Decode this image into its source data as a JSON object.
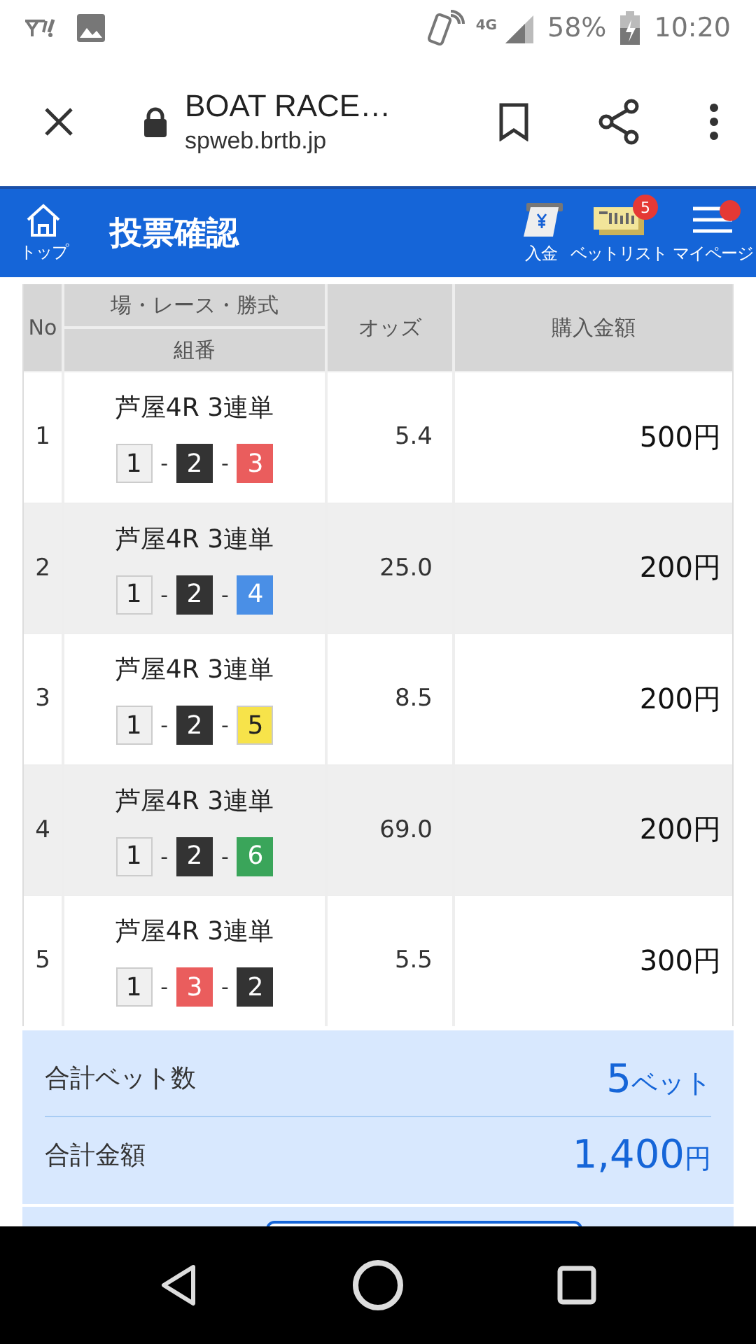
{
  "status_bar": {
    "battery": "58%",
    "time": "10:20",
    "network": "4G"
  },
  "browser": {
    "title": "BOAT RACE…",
    "url": "spweb.brtb.jp"
  },
  "header": {
    "home_label": "トップ",
    "title": "投票確認",
    "actions": [
      {
        "label": "入金",
        "kind": "deposit"
      },
      {
        "label": "ベットリスト",
        "kind": "betlist",
        "badge": "5"
      },
      {
        "label": "マイページ",
        "kind": "mypage",
        "dot": true
      }
    ]
  },
  "table": {
    "columns": [
      "No",
      "場・レース・勝式",
      "組番",
      "オッズ",
      "購入金額"
    ],
    "rows": [
      {
        "no": "1",
        "race": "芦屋4R 3連単",
        "combo": [
          {
            "num": "1",
            "color": "#f0f0f0"
          },
          {
            "num": "2",
            "color": "#333333"
          },
          {
            "num": "3",
            "color": "#ea5d5d"
          }
        ],
        "odds": "5.4",
        "amount": "500円"
      },
      {
        "no": "2",
        "race": "芦屋4R 3連単",
        "combo": [
          {
            "num": "1",
            "color": "#f0f0f0"
          },
          {
            "num": "2",
            "color": "#333333"
          },
          {
            "num": "4",
            "color": "#4a8fe6"
          }
        ],
        "odds": "25.0",
        "amount": "200円"
      },
      {
        "no": "3",
        "race": "芦屋4R 3連単",
        "combo": [
          {
            "num": "1",
            "color": "#f0f0f0"
          },
          {
            "num": "2",
            "color": "#333333"
          },
          {
            "num": "5",
            "color": "#f7e34a"
          }
        ],
        "odds": "8.5",
        "amount": "200円"
      },
      {
        "no": "4",
        "race": "芦屋4R 3連単",
        "combo": [
          {
            "num": "1",
            "color": "#f0f0f0"
          },
          {
            "num": "2",
            "color": "#333333"
          },
          {
            "num": "6",
            "color": "#3aa55a"
          }
        ],
        "odds": "69.0",
        "amount": "200円"
      },
      {
        "no": "5",
        "race": "芦屋4R 3連単",
        "combo": [
          {
            "num": "1",
            "color": "#f0f0f0"
          },
          {
            "num": "3",
            "color": "#ea5d5d"
          },
          {
            "num": "2",
            "color": "#333333"
          }
        ],
        "odds": "5.5",
        "amount": "300円"
      }
    ],
    "separator": "-"
  },
  "summary": [
    {
      "label": "合計ベット数",
      "value": "5",
      "unit": "ベット"
    },
    {
      "label": "合計金額",
      "value": "1,400",
      "unit": "円"
    }
  ]
}
